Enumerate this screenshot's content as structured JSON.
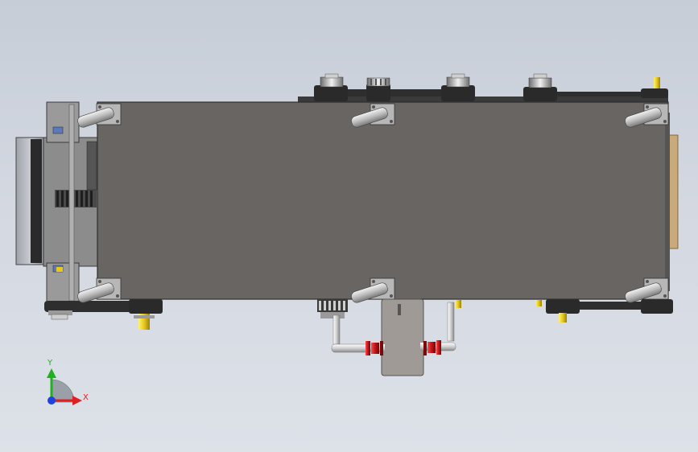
{
  "triad": {
    "x_label": "X",
    "y_label": "Y",
    "x_color": "#e02020",
    "y_color": "#20b020",
    "z_color": "#2040e0"
  },
  "colors": {
    "background_top": "#c7cdd7",
    "background_bottom": "#dde1e8",
    "main_plate": "#686563",
    "plate_edge": "#3c3a38",
    "belt": "#2e2e2e",
    "bracket": "#b7b7b7",
    "pipe": "#e4e4e4",
    "valve": "#c0141c",
    "yellow_part": "#e8c81c",
    "wood_end": "#c9aa78"
  }
}
